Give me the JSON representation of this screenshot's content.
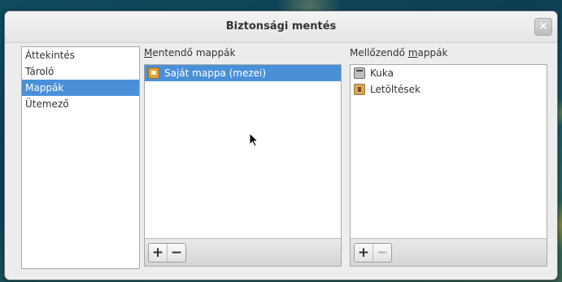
{
  "window": {
    "title": "Biztonsági mentés",
    "close_label": "×"
  },
  "sidebar": {
    "items": [
      {
        "label": "Áttekintés",
        "selected": false
      },
      {
        "label": "Tároló",
        "selected": false
      },
      {
        "label": "Mappák",
        "selected": true
      },
      {
        "label": "Ütemező",
        "selected": false
      }
    ]
  },
  "include_panel": {
    "label_first": "M",
    "label_rest": "entendő mappák",
    "items": [
      {
        "label": "Saját mappa (mezei)",
        "icon": "home-folder-icon",
        "selected": true
      }
    ],
    "add_label": "+",
    "remove_label": "−"
  },
  "exclude_panel": {
    "label_start": "Mellőzendő ",
    "label_mnemonic": "m",
    "label_end": "appák",
    "items": [
      {
        "label": "Kuka",
        "icon": "trash-icon",
        "selected": false
      },
      {
        "label": "Letöltések",
        "icon": "downloads-folder-icon",
        "selected": false
      }
    ],
    "add_label": "+",
    "remove_label": "−",
    "remove_disabled": true
  }
}
